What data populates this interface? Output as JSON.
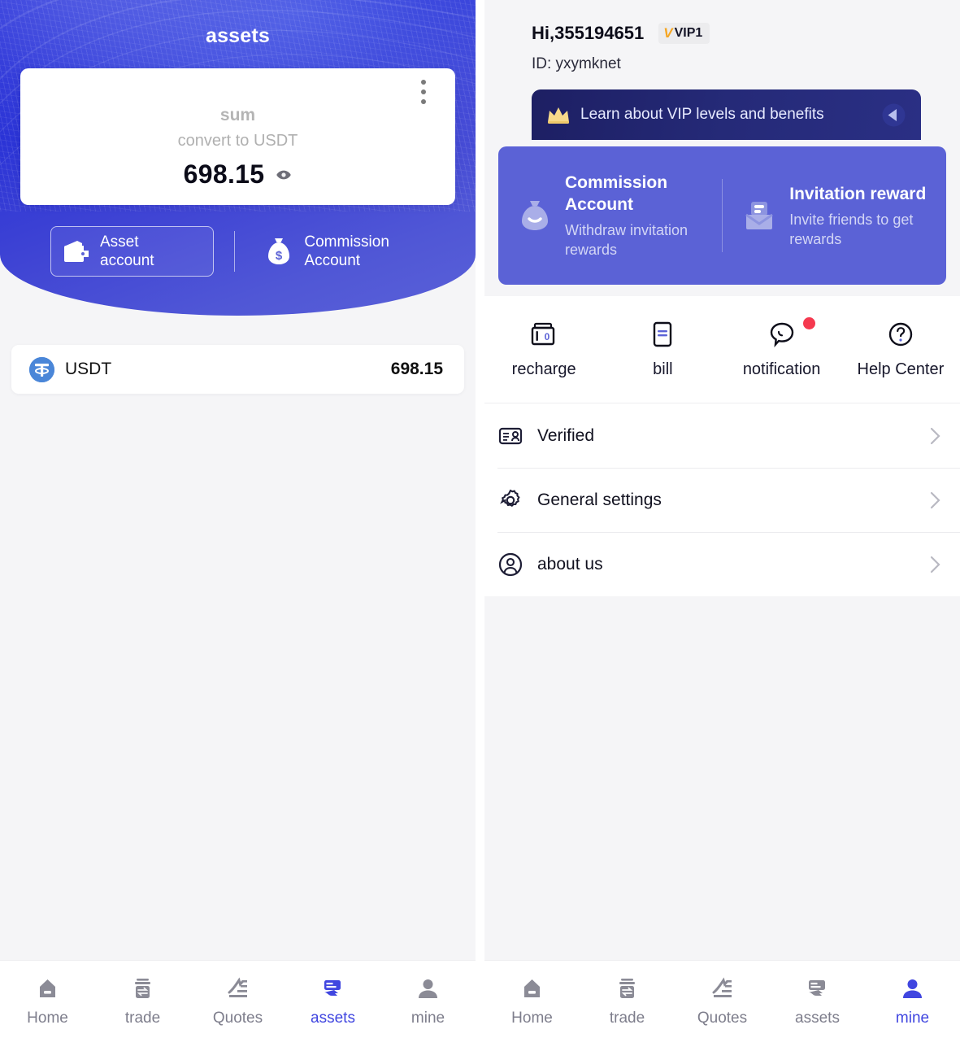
{
  "theme": {
    "brand_blue": "#4046e0",
    "hero_blue_dark": "#1b25d8",
    "hero_blue_light": "#5a61d8",
    "promo_purple": "#5b62d6",
    "vip_banner_navy": "#1d1f63",
    "vip_gold": "#f5a623",
    "notify_red": "#f5394f",
    "usdt_blue": "#4a86d8",
    "page_bg": "#f5f5f7",
    "card_white": "#ffffff",
    "muted_text": "#b4b4b4",
    "tab_inactive": "#7e7e8c"
  },
  "assets_panel": {
    "title": "assets",
    "menu_icon": "more-vertical-icon",
    "balance_card": {
      "label": "sum",
      "sublabel": "convert to USDT",
      "amount": "698.15",
      "visibility_icon": "eye-icon"
    },
    "account_tabs": [
      {
        "label_line1": "Asset",
        "label_line2": "account",
        "icon": "wallet-icon",
        "active": true
      },
      {
        "label_line1": "Commission",
        "label_line2": "Account",
        "icon": "money-bag-icon",
        "active": false
      }
    ],
    "coins": [
      {
        "symbol": "USDT",
        "icon": "usdt-coin-icon",
        "amount": "698.15"
      }
    ],
    "tabbar": [
      {
        "label": "Home",
        "icon": "home-icon",
        "active": false
      },
      {
        "label": "trade",
        "icon": "trade-icon",
        "active": false
      },
      {
        "label": "Quotes",
        "icon": "quotes-icon",
        "active": false
      },
      {
        "label": "assets",
        "icon": "assets-icon",
        "active": true
      },
      {
        "label": "mine",
        "icon": "person-icon",
        "active": false
      }
    ]
  },
  "mine_panel": {
    "greeting": "Hi,355194651",
    "vip_badge": {
      "glyph": "V",
      "label": "VIP1"
    },
    "id_line": "ID: yxymknet",
    "vip_banner": {
      "text": "Learn about VIP levels and benefits",
      "crown_icon": "crown-icon",
      "arrow_icon": "arrow-left-circle-icon"
    },
    "promo": [
      {
        "title": "Commission Account",
        "subtitle": "Withdraw invitation rewards",
        "icon": "money-bag-icon"
      },
      {
        "title": "Invitation reward",
        "subtitle": "Invite friends to get rewards",
        "icon": "envelope-icon"
      }
    ],
    "quick_actions": [
      {
        "label": "recharge",
        "icon": "wallet-zero-icon",
        "badge": false
      },
      {
        "label": "bill",
        "icon": "bill-icon",
        "badge": false
      },
      {
        "label": "notification",
        "icon": "chat-bubble-icon",
        "badge": true
      },
      {
        "label": "Help Center",
        "icon": "question-circle-icon",
        "badge": false
      }
    ],
    "menu": [
      {
        "label": "Verified",
        "icon": "id-card-icon",
        "chevron": "chevron-right-icon"
      },
      {
        "label": "General settings",
        "icon": "gear-icon",
        "chevron": "chevron-right-icon"
      },
      {
        "label": "about us",
        "icon": "user-circle-icon",
        "chevron": "chevron-right-icon"
      }
    ],
    "tabbar": [
      {
        "label": "Home",
        "icon": "home-icon",
        "active": false
      },
      {
        "label": "trade",
        "icon": "trade-icon",
        "active": false
      },
      {
        "label": "Quotes",
        "icon": "quotes-icon",
        "active": false
      },
      {
        "label": "assets",
        "icon": "assets-icon",
        "active": false
      },
      {
        "label": "mine",
        "icon": "person-icon",
        "active": true
      }
    ]
  }
}
